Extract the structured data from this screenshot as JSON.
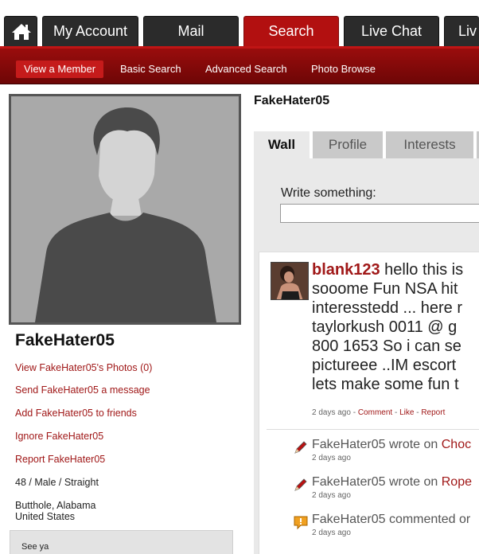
{
  "topnav": {
    "home_icon": "home-icon",
    "tabs": [
      {
        "label": "My Account"
      },
      {
        "label": "Mail"
      },
      {
        "label": "Search"
      },
      {
        "label": "Live Chat"
      },
      {
        "label": "Liv"
      }
    ]
  },
  "subnav": {
    "items": [
      {
        "label": "View a Member"
      },
      {
        "label": "Basic Search"
      },
      {
        "label": "Advanced Search"
      },
      {
        "label": "Photo Browse"
      }
    ]
  },
  "sidebar": {
    "name": "FakeHater05",
    "links": [
      {
        "label": "View FakeHater05's Photos (0)"
      },
      {
        "label": "Send FakeHater05 a message"
      },
      {
        "label": "Add FakeHater05 to friends"
      },
      {
        "label": "Ignore FakeHater05"
      },
      {
        "label": "Report FakeHater05"
      }
    ],
    "details": "48 / Male / Straight",
    "location_line1": "Butthole, Alabama",
    "location_line2": "United States",
    "status": "See ya"
  },
  "main": {
    "name": "FakeHater05",
    "tabs": [
      {
        "label": "Wall"
      },
      {
        "label": "Profile"
      },
      {
        "label": "Interests"
      }
    ],
    "write_label": "Write something:",
    "write_value": "",
    "post": {
      "user": "blank123",
      "lines": [
        "hello this is",
        "sooome Fun NSA hit",
        "interesstedd ... here r",
        "taylorkush 0011 @ g",
        "800 1653 So i can se",
        "pictureee ..IM escort",
        "lets make some fun t"
      ],
      "time": "2 days ago",
      "sep1": " - ",
      "comment_label": "Comment",
      "sep2": " - ",
      "like_label": "Like",
      "sep3": " - ",
      "report_label": "Report"
    },
    "activity": [
      {
        "icon": "pencil-icon",
        "text": "FakeHater05 wrote on ",
        "target": "Choc",
        "time": "2 days ago"
      },
      {
        "icon": "pencil-icon",
        "text": "FakeHater05 wrote on ",
        "target": "Rope",
        "time": "2 days ago"
      },
      {
        "icon": "comment-bubble-icon",
        "text": "FakeHater05 commented or",
        "target": "",
        "time": "2 days ago"
      }
    ]
  },
  "colors": {
    "brand_red": "#b21010",
    "link_red": "#a01818",
    "nav_dark": "#2b2b2b"
  }
}
